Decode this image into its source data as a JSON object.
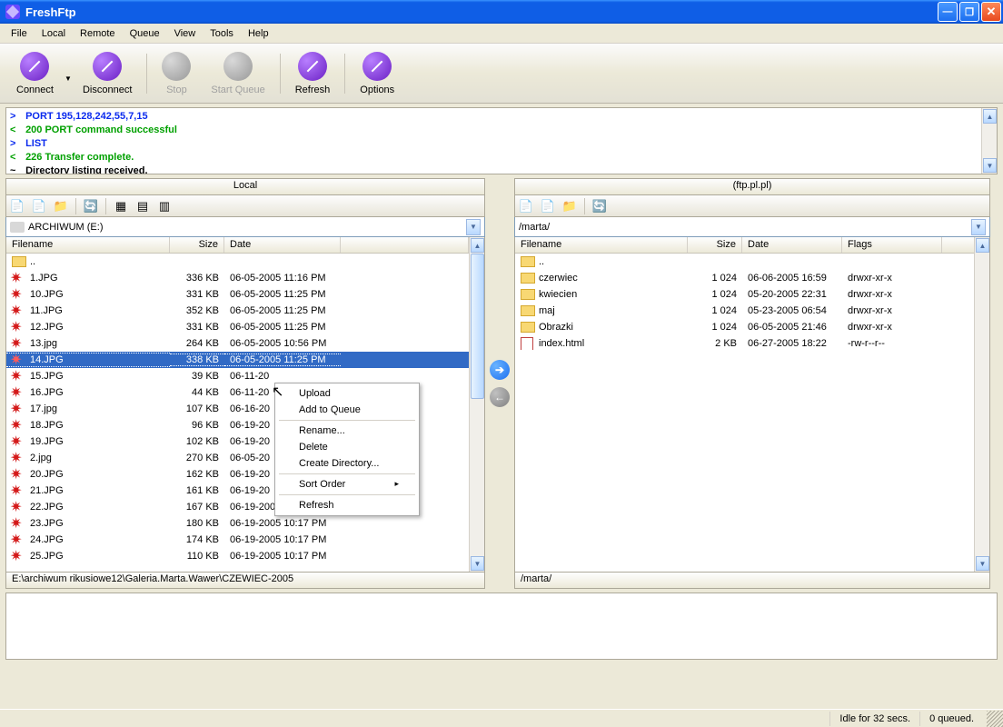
{
  "window": {
    "title": "FreshFtp"
  },
  "menu": [
    "File",
    "Local",
    "Remote",
    "Queue",
    "View",
    "Tools",
    "Help"
  ],
  "toolbar": [
    {
      "label": "Connect",
      "icon": "purple",
      "enabled": true,
      "dropdown": true
    },
    {
      "label": "Disconnect",
      "icon": "purple",
      "enabled": true
    },
    {
      "label": "Stop",
      "icon": "gray",
      "enabled": false
    },
    {
      "label": "Start Queue",
      "icon": "gray",
      "enabled": false
    },
    {
      "label": "Refresh",
      "icon": "purple",
      "enabled": true
    },
    {
      "label": "Options",
      "icon": "purple",
      "enabled": true
    }
  ],
  "log": [
    {
      "mark": ">",
      "cls": "blue",
      "text": "PORT 195,128,242,55,7,15"
    },
    {
      "mark": "<",
      "cls": "green",
      "text": "200 PORT command successful"
    },
    {
      "mark": ">",
      "cls": "blue",
      "text": "LIST"
    },
    {
      "mark": "<",
      "cls": "green",
      "text": "226 Transfer complete."
    },
    {
      "mark": "~",
      "cls": "black",
      "text": "Directory listing received."
    }
  ],
  "local": {
    "header": "Local",
    "drive": "ARCHIWUM (E:)",
    "columns": [
      "Filename",
      "Size",
      "Date"
    ],
    "path": "E:\\archiwum rikusiowe12\\Galeria.Marta.Wawer\\CZEWIEC-2005",
    "rows": [
      {
        "icon": "parent",
        "name": "..",
        "size": "",
        "date": "",
        "sel": false
      },
      {
        "icon": "jpg",
        "name": "1.JPG",
        "size": "336 KB",
        "date": "06-05-2005 11:16 PM",
        "sel": false
      },
      {
        "icon": "jpg",
        "name": "10.JPG",
        "size": "331 KB",
        "date": "06-05-2005 11:25 PM",
        "sel": false
      },
      {
        "icon": "jpg",
        "name": "11.JPG",
        "size": "352 KB",
        "date": "06-05-2005 11:25 PM",
        "sel": false
      },
      {
        "icon": "jpg",
        "name": "12.JPG",
        "size": "331 KB",
        "date": "06-05-2005 11:25 PM",
        "sel": false
      },
      {
        "icon": "jpg",
        "name": "13.jpg",
        "size": "264 KB",
        "date": "06-05-2005 10:56 PM",
        "sel": false
      },
      {
        "icon": "jpg",
        "name": "14.JPG",
        "size": "338 KB",
        "date": "06-05-2005 11:25 PM",
        "sel": true
      },
      {
        "icon": "jpg",
        "name": "15.JPG",
        "size": "39 KB",
        "date": "06-11-20",
        "sel": false
      },
      {
        "icon": "jpg",
        "name": "16.JPG",
        "size": "44 KB",
        "date": "06-11-20",
        "sel": false
      },
      {
        "icon": "jpg",
        "name": "17.jpg",
        "size": "107 KB",
        "date": "06-16-20",
        "sel": false
      },
      {
        "icon": "jpg",
        "name": "18.JPG",
        "size": "96 KB",
        "date": "06-19-20",
        "sel": false
      },
      {
        "icon": "jpg",
        "name": "19.JPG",
        "size": "102 KB",
        "date": "06-19-20",
        "sel": false
      },
      {
        "icon": "jpg",
        "name": "2.jpg",
        "size": "270 KB",
        "date": "06-05-20",
        "sel": false
      },
      {
        "icon": "jpg",
        "name": "20.JPG",
        "size": "162 KB",
        "date": "06-19-20",
        "sel": false
      },
      {
        "icon": "jpg",
        "name": "21.JPG",
        "size": "161 KB",
        "date": "06-19-20",
        "sel": false
      },
      {
        "icon": "jpg",
        "name": "22.JPG",
        "size": "167 KB",
        "date": "06-19-2005 10:16 PM",
        "sel": false
      },
      {
        "icon": "jpg",
        "name": "23.JPG",
        "size": "180 KB",
        "date": "06-19-2005 10:17 PM",
        "sel": false
      },
      {
        "icon": "jpg",
        "name": "24.JPG",
        "size": "174 KB",
        "date": "06-19-2005 10:17 PM",
        "sel": false
      },
      {
        "icon": "jpg",
        "name": "25.JPG",
        "size": "110 KB",
        "date": "06-19-2005 10:17 PM",
        "sel": false
      }
    ]
  },
  "remote": {
    "header": "(ftp.pl.pl)",
    "path_combo": "/marta/",
    "columns": [
      "Filename",
      "Size",
      "Date",
      "Flags"
    ],
    "path": "/marta/",
    "rows": [
      {
        "icon": "parent",
        "name": "..",
        "size": "",
        "date": "",
        "flags": ""
      },
      {
        "icon": "folder",
        "name": "czerwiec",
        "size": "1 024",
        "date": "06-06-2005 16:59",
        "flags": "drwxr-xr-x"
      },
      {
        "icon": "folder",
        "name": "kwiecien",
        "size": "1 024",
        "date": "05-20-2005 22:31",
        "flags": "drwxr-xr-x"
      },
      {
        "icon": "folder",
        "name": "maj",
        "size": "1 024",
        "date": "05-23-2005 06:54",
        "flags": "drwxr-xr-x"
      },
      {
        "icon": "folder",
        "name": "Obrazki",
        "size": "1 024",
        "date": "06-05-2005 21:46",
        "flags": "drwxr-xr-x"
      },
      {
        "icon": "html",
        "name": "index.html",
        "size": "2 KB",
        "date": "06-27-2005 18:22",
        "flags": "-rw-r--r--"
      }
    ]
  },
  "context_menu": [
    "Upload",
    "Add to Queue",
    "-",
    "Rename...",
    "Delete",
    "Create Directory...",
    "-",
    "Sort Order",
    "-",
    "Refresh"
  ],
  "context_submenu_index": 7,
  "status": {
    "idle": "Idle for 32 secs.",
    "queued": "0 queued."
  }
}
